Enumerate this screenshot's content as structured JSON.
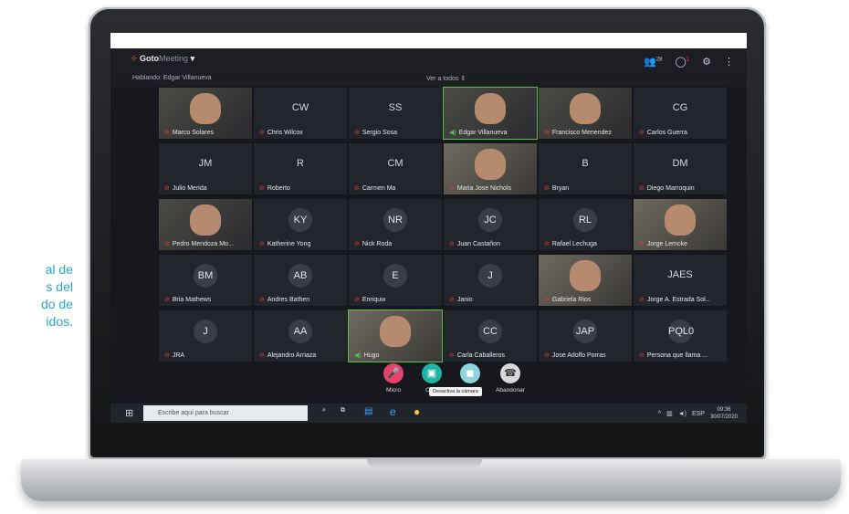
{
  "side_text": [
    "al de",
    "s del",
    "do de",
    "idos."
  ],
  "app": {
    "logo_prefix": "Goto",
    "logo_suffix": "Meeting",
    "speaking": "Hablando: Edgar Villanueva",
    "view_all": "Ver a todos",
    "participant_count": "28",
    "notification_count": "1"
  },
  "tiles": [
    {
      "name": "Marco Solares",
      "type": "video",
      "muted": true
    },
    {
      "name": "Chris Wilcox",
      "initials": "CW",
      "muted": true
    },
    {
      "name": "Sergio Sosa",
      "initials": "SS",
      "muted": true
    },
    {
      "name": "Edgar Villanueva",
      "type": "video",
      "muted": false,
      "active": true
    },
    {
      "name": "Francisco Menendez",
      "type": "video",
      "muted": true
    },
    {
      "name": "Carlos Guerra",
      "initials": "CG",
      "muted": true
    },
    {
      "name": "Julio Merida",
      "initials": "JM",
      "muted": true
    },
    {
      "name": "Roberto",
      "initials": "R",
      "muted": true
    },
    {
      "name": "Carmen Ma",
      "initials": "CM",
      "muted": true
    },
    {
      "name": "Maria Jose Nichols",
      "type": "video2",
      "muted": true
    },
    {
      "name": "Bryan",
      "initials": "B",
      "muted": true
    },
    {
      "name": "Diego Marroquin",
      "initials": "DM",
      "muted": true
    },
    {
      "name": "Pedro Mendoza Mo...",
      "type": "video",
      "muted": true
    },
    {
      "name": "Katherine Yong",
      "circle": "KY",
      "muted": true
    },
    {
      "name": "Nick Roda",
      "circle": "NR",
      "muted": true
    },
    {
      "name": "Juan Castañon",
      "circle": "JC",
      "muted": true
    },
    {
      "name": "Rafael Lechuga",
      "circle": "RL",
      "muted": true
    },
    {
      "name": "Jorge Lemcke",
      "type": "video2",
      "muted": true
    },
    {
      "name": "Bria Mathews",
      "circle": "BM",
      "muted": true
    },
    {
      "name": "Andres Bathen",
      "circle": "AB",
      "muted": true
    },
    {
      "name": "Enriquw",
      "circle": "E",
      "muted": true
    },
    {
      "name": "Janio",
      "circle": "J",
      "muted": true
    },
    {
      "name": "Gabriela Rios",
      "type": "video2",
      "muted": true
    },
    {
      "name": "Jorge A. Estrada Sol...",
      "initials": "JAES",
      "muted": true
    },
    {
      "name": "JRA",
      "circle": "J",
      "muted": true
    },
    {
      "name": "Alejandro Arriaza",
      "circle": "AA",
      "muted": true
    },
    {
      "name": "Hugo",
      "type": "video2",
      "muted": false,
      "active": true
    },
    {
      "name": "Carla Caballeros",
      "circle": "CC",
      "muted": true
    },
    {
      "name": "Jose Adolfo Porras",
      "circle": "JAP",
      "muted": true
    },
    {
      "name": "Persona que llama ...",
      "circle": "PQL0",
      "muted": true
    }
  ],
  "controls": {
    "mic": "Micro",
    "camera": "Cám",
    "leave": "Abandonar",
    "tooltip": "Desactiva la cámara"
  },
  "taskbar": {
    "search_placeholder": "Escribe aquí para buscar",
    "language": "ESP",
    "time": "09:36",
    "date": "30/07/2020"
  },
  "colors": {
    "mic_button": "#e8426a",
    "camera_button": "#1fb3a2",
    "leave_button": "#d7d9dd",
    "side_text": "#2aa6c9"
  }
}
